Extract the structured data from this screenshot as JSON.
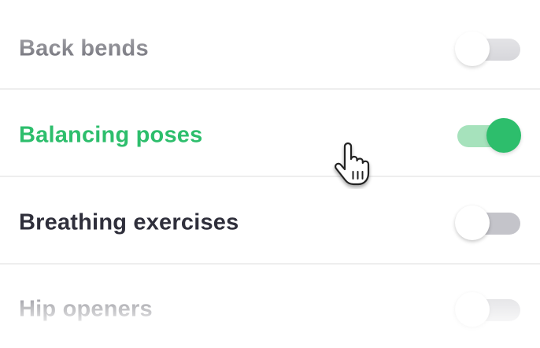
{
  "settings": {
    "items": [
      {
        "label": "Back bends",
        "enabled": false
      },
      {
        "label": "Balancing poses",
        "enabled": true
      },
      {
        "label": "Breathing exercises",
        "enabled": false
      },
      {
        "label": "Hip openers",
        "enabled": false
      }
    ]
  },
  "cursor": {
    "icon": "hand-pointer-icon"
  },
  "colors": {
    "accent": "#2dbe6c",
    "accent_track": "#a6e2bc",
    "label_default": "#2f2f3b",
    "track_off": "#c4c4ca",
    "divider": "#eeeeee"
  }
}
